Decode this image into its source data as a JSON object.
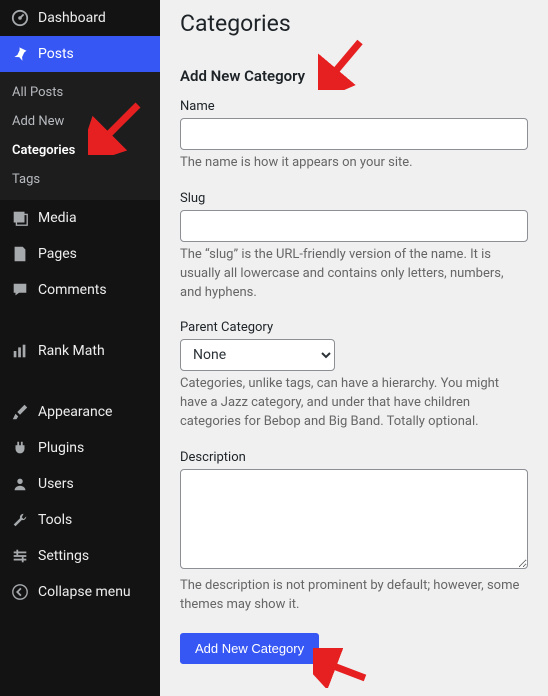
{
  "sidebar": {
    "dashboard": "Dashboard",
    "posts": "Posts",
    "postsSub": {
      "all": "All Posts",
      "addNew": "Add New",
      "categories": "Categories",
      "tags": "Tags"
    },
    "media": "Media",
    "pages": "Pages",
    "comments": "Comments",
    "rankMath": "Rank Math",
    "appearance": "Appearance",
    "plugins": "Plugins",
    "users": "Users",
    "tools": "Tools",
    "settings": "Settings",
    "collapse": "Collapse menu"
  },
  "page": {
    "title": "Categories",
    "formTitle": "Add New Category",
    "name": {
      "label": "Name",
      "value": "",
      "help": "The name is how it appears on your site."
    },
    "slug": {
      "label": "Slug",
      "value": "",
      "help": "The “slug” is the URL-friendly version of the name. It is usually all lowercase and contains only letters, numbers, and hyphens."
    },
    "parent": {
      "label": "Parent Category",
      "selected": "None",
      "help": "Categories, unlike tags, can have a hierarchy. You might have a Jazz category, and under that have children categories for Bebop and Big Band. Totally optional."
    },
    "description": {
      "label": "Description",
      "value": "",
      "help": "The description is not prominent by default; however, some themes may show it."
    },
    "submit": "Add New Category"
  }
}
